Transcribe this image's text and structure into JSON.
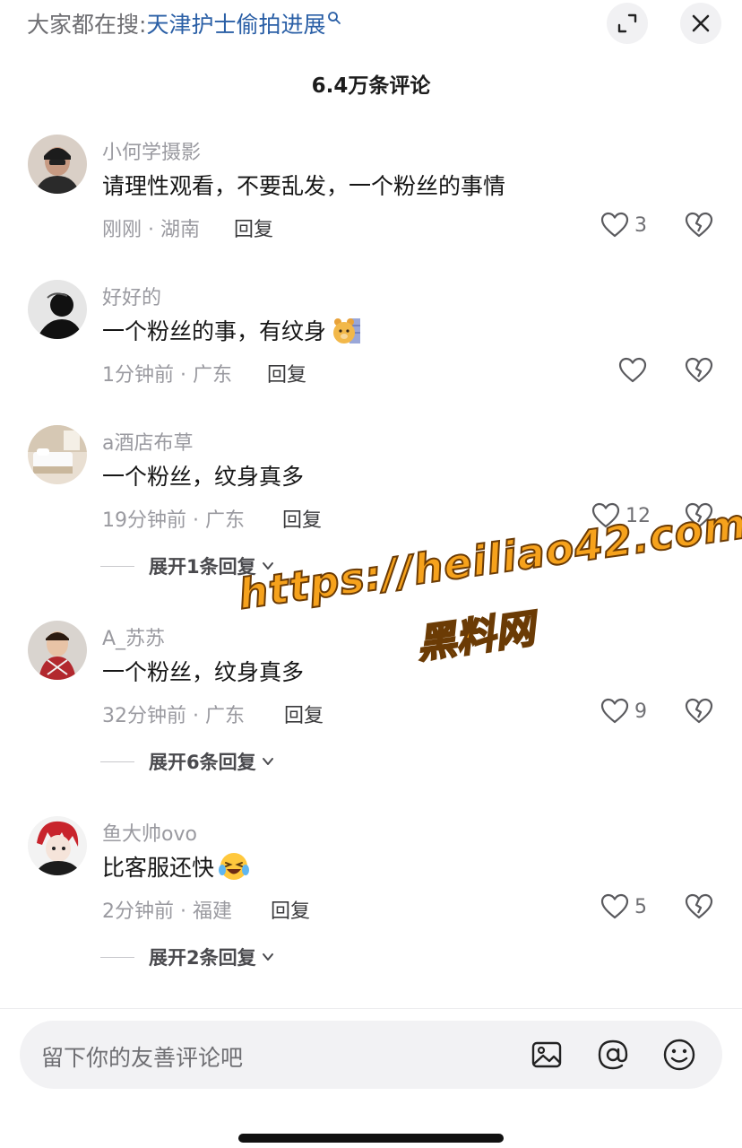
{
  "header": {
    "search_prefix": "大家都在搜:",
    "search_term": "天津护士偷拍进展",
    "comment_count": "6.4万条评论"
  },
  "comments": [
    {
      "username": "小何学摄影",
      "text": "请理性观看，不要乱发，一个粉丝的事情",
      "meta": "刚刚 · 湖南",
      "reply": "回复",
      "likes": "3"
    },
    {
      "username": "好好的",
      "text": "一个粉丝的事，有纹身",
      "meta": "1分钟前 · 广东",
      "reply": "回复",
      "likes": ""
    },
    {
      "username": "a酒店布草",
      "text": "一个粉丝，纹身真多",
      "meta": "19分钟前 · 广东",
      "reply": "回复",
      "likes": "12",
      "expand": "展开1条回复"
    },
    {
      "username": "A_苏苏",
      "text": "一个粉丝，纹身真多",
      "meta": "32分钟前 · 广东",
      "reply": "回复",
      "likes": "9",
      "expand": "展开6条回复"
    },
    {
      "username": "鱼大帅ovo",
      "text": "比客服还快",
      "meta": "2分钟前 · 福建",
      "reply": "回复",
      "likes": "5",
      "expand": "展开2条回复"
    }
  ],
  "watermark": {
    "url": "https://heiliao42.com",
    "name": "黑料网"
  },
  "input": {
    "placeholder": "留下你的友善评论吧"
  },
  "icons": [
    "search-icon",
    "expand-icon",
    "close-icon",
    "heart-icon",
    "broken-heart-icon",
    "chevron-down-icon",
    "image-icon",
    "at-icon",
    "emoji-icon"
  ],
  "colors": {
    "search_term": "#2a5fa6",
    "watermark": "#f6a21c"
  }
}
